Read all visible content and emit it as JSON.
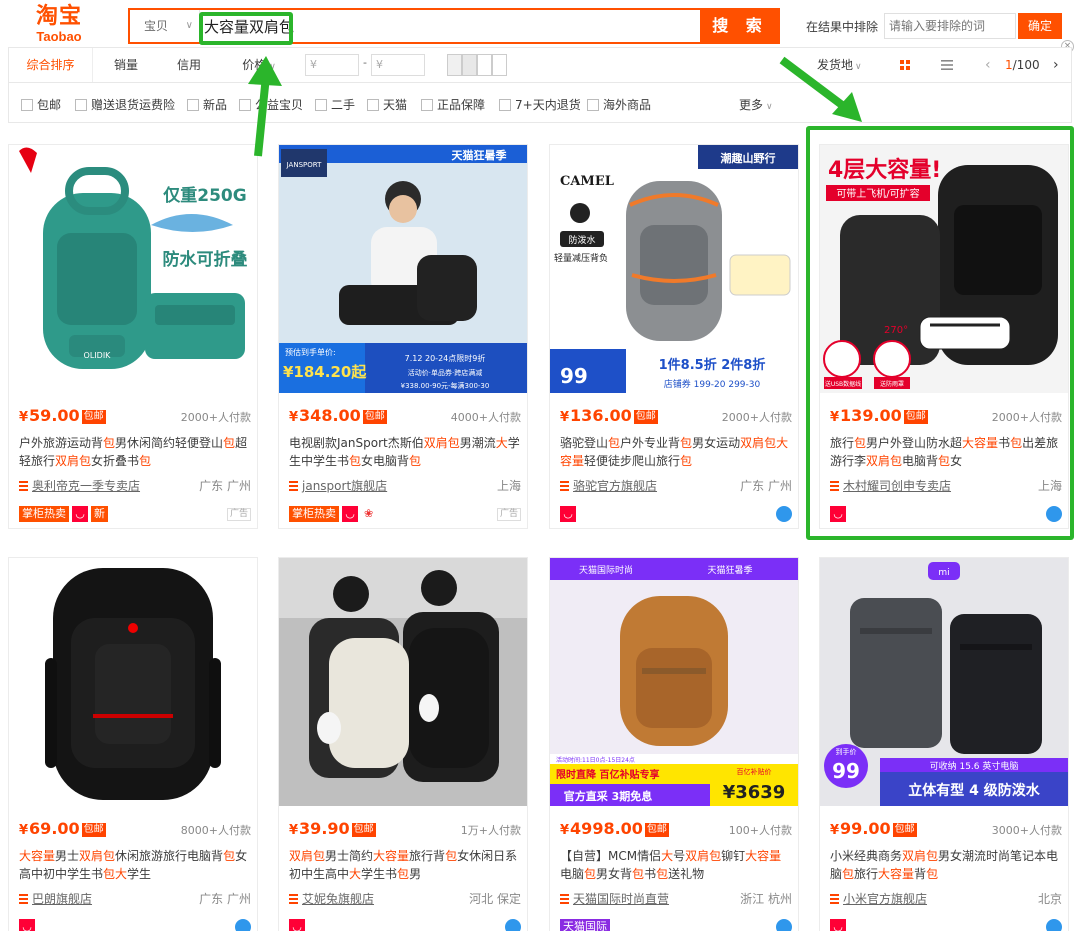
{
  "header": {
    "logo_cn": "淘宝",
    "logo_en": "Taobao",
    "search_category": "宝贝",
    "search_query": "大容量双肩包",
    "search_button": "搜 索",
    "exclude_label": "在结果中排除",
    "exclude_placeholder": "请输入要排除的词",
    "confirm_button": "确定"
  },
  "sortbar": {
    "tabs": [
      "综合排序",
      "销量",
      "信用",
      "价格"
    ],
    "price_from": "¥",
    "price_to": "¥",
    "dash": "-",
    "ship_from": "发货地",
    "page_current": "1",
    "page_total": "/100"
  },
  "filters": {
    "items": [
      "包邮",
      "赠送退货运费险",
      "新品",
      "公益宝贝",
      "二手",
      "天猫",
      "正品保障",
      "7+天内退货",
      "海外商品"
    ],
    "more": "更多"
  },
  "products": [
    {
      "price": "59.00",
      "paid": "2000+人付款",
      "title": "户外旅游运动背包男休闲简约轻便登山包超轻旅行双肩包女折叠书包",
      "shop": "奥利帝克一季专卖店",
      "location": "广东 广州",
      "badges": [
        "掌柜热卖",
        "新"
      ],
      "ad": "广告",
      "img_text": [
        "仅重250G",
        "防水可折叠",
        "OLIDIK"
      ]
    },
    {
      "price": "348.00",
      "paid": "4000+人付款",
      "title": "电视剧款JanSport杰斯伯双肩包男潮流大学生中学生书包女电脑背包",
      "shop": "jansport旗舰店",
      "location": "上海",
      "badges": [
        "掌柜热卖"
      ],
      "ad": "广告",
      "img_text": [
        "天猫狂暑季",
        "预估到手单价:",
        "¥184.20起",
        "7.12 20-24点限时9折",
        "活动价·单品券·跨店满减",
        "¥338.00-90元-每满300-30",
        "JANSPORT"
      ]
    },
    {
      "price": "136.00",
      "paid": "2000+人付款",
      "title": "骆驼登山包户外专业背包男女运动双肩包大容量轻便徒步爬山旅行包",
      "shop": "骆驼官方旗舰店",
      "location": "广东 广州",
      "badges": [],
      "ad": "",
      "img_text": [
        "CAMEL",
        "潮趣山野行",
        "防泼水",
        "轻量减压背负",
        "1件8.5折 2件8折",
        "店铺券 199-20 299-30",
        "99"
      ]
    },
    {
      "price": "139.00",
      "paid": "2000+人付款",
      "title": "旅行包男户外登山防水超大容量书包出差旅游行李双肩包电脑背包女",
      "shop": "木村耀司创申专卖店",
      "location": "上海",
      "badges": [],
      "ad": "",
      "img_text": [
        "4层大容量!",
        "可带上飞机/可扩容",
        "270°",
        "送USB数据线",
        "送防雨罩"
      ]
    },
    {
      "price": "69.00",
      "paid": "8000+人付款",
      "title": "大容量男士双肩包休闲旅游旅行电脑背包女高中初中学生书包大学生",
      "shop": "巴朗旗舰店",
      "location": "广东 广州",
      "badges": [],
      "ad": "",
      "img_text": []
    },
    {
      "price": "39.90",
      "paid": "1万+人付款",
      "title": "双肩包男士简约大容量旅行背包女休闲日系初中生高中大学生书包男",
      "shop": "艾妮兔旗舰店",
      "location": "河北 保定",
      "badges": [],
      "ad": "",
      "img_text": []
    },
    {
      "price": "4998.00",
      "paid": "100+人付款",
      "title": "【自营】MCM情侣大号双肩包铆钉大容量电脑包男女背包书包送礼物",
      "shop": "天猫国际时尚直营",
      "location": "浙江 杭州",
      "badges": [
        "天猫国际"
      ],
      "ad": "",
      "img_text": [
        "天猫国际时尚",
        "天猫狂暑季",
        "活动时间:11日0点-15日24点",
        "限时直降 百亿补贴专享",
        "官方直采 3期免息",
        "百亿补贴价",
        "¥3639"
      ]
    },
    {
      "price": "99.00",
      "paid": "3000+人付款",
      "title": "小米经典商务双肩包男女潮流时尚笔记本电脑包旅行大容量背包",
      "shop": "小米官方旗舰店",
      "location": "北京",
      "badges": [],
      "ad": "",
      "img_text": [
        "到手价",
        "99",
        "可收纳 15.6 英寸电脑",
        "立体有型 4 级防泼水"
      ]
    }
  ],
  "colors": {
    "accent": "#ff5000",
    "price": "#ff4400",
    "highlight": "#2bb52b"
  }
}
